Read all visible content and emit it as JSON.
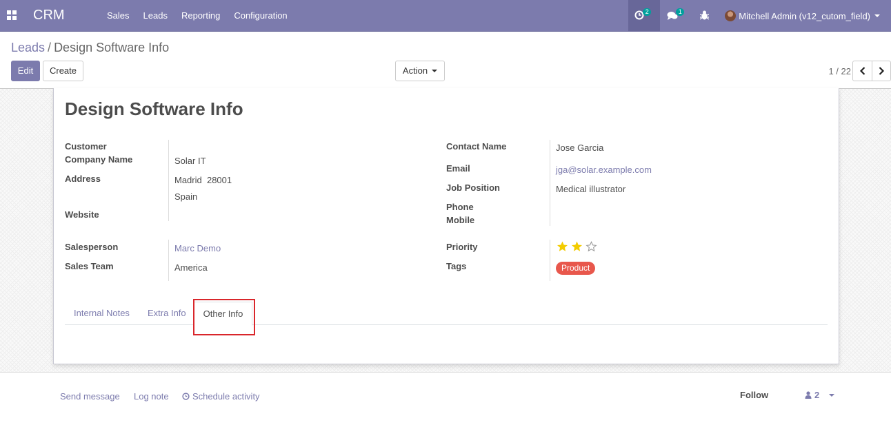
{
  "navbar": {
    "brand": "CRM",
    "menu": [
      "Sales",
      "Leads",
      "Reporting",
      "Configuration"
    ],
    "activity_count": "2",
    "messages_count": "1",
    "user_name": "Mitchell Admin (v12_cutom_field)",
    "icons": [
      "apps-icon",
      "activity-clock-icon",
      "chat-bubbles-icon",
      "bug-icon",
      "user-avatar"
    ]
  },
  "breadcrumb": {
    "parent": "Leads",
    "separator": "/",
    "current": "Design Software Info"
  },
  "buttons": {
    "edit": "Edit",
    "create": "Create",
    "action": "Action"
  },
  "pager": {
    "value": "1 / 22"
  },
  "form": {
    "title": "Design Software Info",
    "left_fields": {
      "customer": "Customer",
      "company_name_label": "Company Name",
      "company_name": "Solar IT",
      "address_label": "Address",
      "address_line1": "Madrid  28001",
      "address_line2": "Spain",
      "website_label": "Website",
      "salesperson_label": "Salesperson",
      "salesperson": "Marc Demo",
      "sales_team_label": "Sales Team",
      "sales_team": "America"
    },
    "right_fields": {
      "contact_name_label": "Contact Name",
      "contact_name": "Jose Garcia",
      "email_label": "Email",
      "email": "jga@solar.example.com",
      "job_position_label": "Job Position",
      "job_position": "Medical illustrator",
      "phone_label": "Phone",
      "mobile_label": "Mobile",
      "priority_label": "Priority",
      "priority_stars": 2,
      "priority_max": 3,
      "tags_label": "Tags",
      "tag": "Product"
    },
    "tabs": [
      "Internal Notes",
      "Extra Info",
      "Other Info"
    ],
    "active_tab": "Other Info"
  },
  "chatter": {
    "send_message": "Send message",
    "log_note": "Log note",
    "schedule_activity": "Schedule activity",
    "follow": "Follow",
    "followers_count": "2"
  },
  "colors": {
    "primary": "#7c7bad",
    "tag": "#e8574c",
    "star": "#f3cc00",
    "badge": "#00a09d",
    "highlight": "#d9262b"
  }
}
